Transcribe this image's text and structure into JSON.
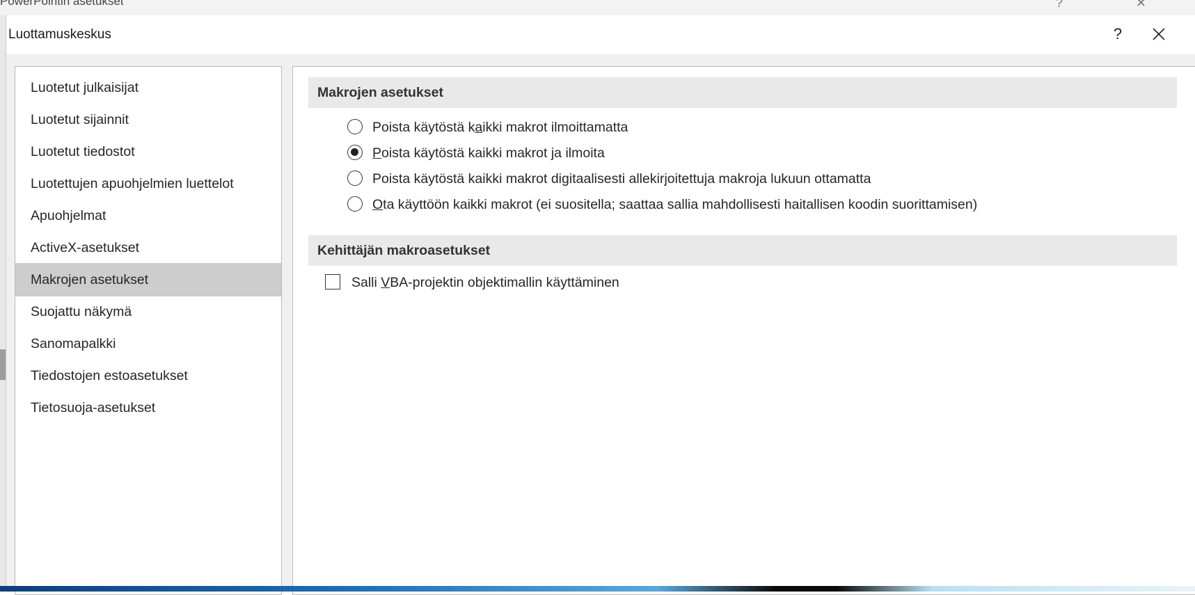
{
  "background_window": {
    "title": "PowerPointin asetukset",
    "controls": "? ✕"
  },
  "dialog": {
    "title": "Luottamuskeskus",
    "help_label": "?",
    "close_icon": "close-icon"
  },
  "sidebar": {
    "items": [
      {
        "label": "Luotetut julkaisijat",
        "selected": false
      },
      {
        "label": "Luotetut sijainnit",
        "selected": false
      },
      {
        "label": "Luotetut tiedostot",
        "selected": false
      },
      {
        "label": "Luotettujen apuohjelmien luettelot",
        "selected": false
      },
      {
        "label": "Apuohjelmat",
        "selected": false
      },
      {
        "label": "ActiveX-asetukset",
        "selected": false
      },
      {
        "label": "Makrojen asetukset",
        "selected": true
      },
      {
        "label": "Suojattu näkymä",
        "selected": false
      },
      {
        "label": "Sanomapalkki",
        "selected": false
      },
      {
        "label": "Tiedostojen estoasetukset",
        "selected": false
      },
      {
        "label": "Tietosuoja-asetukset",
        "selected": false
      }
    ]
  },
  "main": {
    "macro_section": {
      "header": "Makrojen asetukset",
      "options": [
        {
          "pre": "Poista käytöstä k",
          "accel": "a",
          "post": "ikki makrot ilmoittamatta",
          "checked": false
        },
        {
          "pre": "",
          "accel": "P",
          "post": "oista käytöstä kaikki makrot ja ilmoita",
          "checked": true
        },
        {
          "pre": "Poista käytöstä kaikki makrot di",
          "accel": "g",
          "post": "itaalisesti allekirjoitettuja makroja lukuun ottamatta",
          "checked": false
        },
        {
          "pre": "",
          "accel": "O",
          "post": "ta käyttöön kaikki makrot (ei suositella; saattaa sallia mahdollisesti haitallisen koodin suorittamisen)",
          "checked": false
        }
      ]
    },
    "developer_section": {
      "header": "Kehittäjän makroasetukset",
      "checkbox": {
        "pre": "Salli ",
        "accel": "V",
        "post": "BA-projektin objektimallin käyttäminen",
        "checked": false
      }
    }
  },
  "colors": {
    "selected_item": "#cdcdcd",
    "section_header_bg": "#e9e9e9",
    "dialog_bg": "#f0f0f0"
  }
}
